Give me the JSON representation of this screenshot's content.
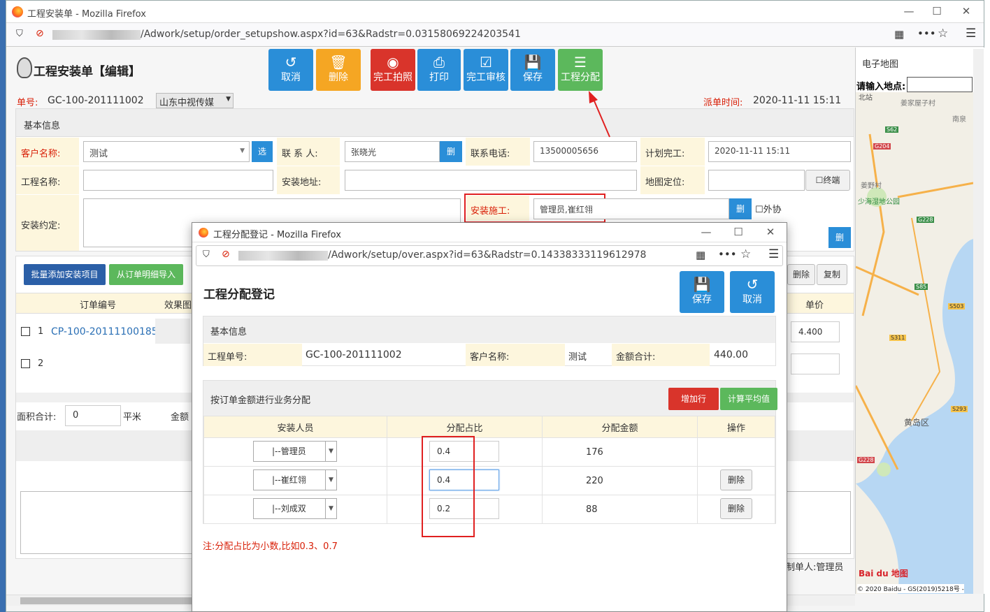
{
  "main_window": {
    "title": "工程安装单 - Mozilla Firefox",
    "url": "/Adwork/setup/order_setupshow.aspx?id=63&Radstr=0.03158069224203541"
  },
  "header": {
    "title": "工程安装单【编辑】",
    "order_no_label": "单号:",
    "order_no": "GC-100-201111002",
    "company": "山东中视传媒",
    "dispatch_label": "派单时间:",
    "dispatch_time": "2020-11-11 15:11"
  },
  "toolbar": {
    "cancel": "取消",
    "delete": "删除",
    "photo": "完工拍照",
    "print": "打印",
    "review": "完工审核",
    "save": "保存",
    "assign": "工程分配"
  },
  "basic_info": {
    "section": "基本信息",
    "customer_label": "客户名称:",
    "customer": "测试",
    "select_btn": "选",
    "contact_label": "联 系 人:",
    "contact": "张晓光",
    "del_btn": "删",
    "phone_label": "联系电话:",
    "phone": "13500005656",
    "plan_label": "计划完工:",
    "plan": "2020-11-11 15:11",
    "project_label": "工程名称:",
    "address_label": "安装地址:",
    "mapcoord_label": "地图定位:",
    "terminal": "终端",
    "agreement_label": "安装约定:",
    "installer_label": "安装施工:",
    "installer": "管理员,崔红翎",
    "outsource": "外协"
  },
  "items": {
    "add_batch": "批量添加安装项目",
    "import": "从订单明细导入",
    "delete": "删除",
    "copy": "复制",
    "col_order": "订单编号",
    "col_effect": "效果图",
    "col_price": "单价",
    "row1_no": "1",
    "row1_order": "CP-100-20111100185",
    "row1_price": "4.400",
    "row2_no": "2",
    "area_label": "面积合计:",
    "area": "0",
    "area_unit": "平米",
    "amount_label": "金额"
  },
  "footer": {
    "maker_label": "制单人:",
    "maker": "管理员"
  },
  "map": {
    "title": "电子地图",
    "search_label": "请输入地点:",
    "labels": [
      "北站",
      "姜家屋子村",
      "南泉",
      "G204",
      "S62",
      "姜野村",
      "少海湿地公园",
      "G228",
      "S85",
      "S503",
      "S311",
      "黄岛区",
      "S293",
      "G228"
    ],
    "logo": "Bai du 地图",
    "copyright": "© 2020 Baidu - GS(2019)5218号 -"
  },
  "popup": {
    "title": "工程分配登记 - Mozilla Firefox",
    "url": "/Adwork/setup/over.aspx?id=63&Radstr=0.14338333119612978",
    "heading": "工程分配登记",
    "save": "保存",
    "cancel": "取消",
    "basic_section": "基本信息",
    "project_no_label": "工程单号:",
    "project_no": "GC-100-201111002",
    "customer_label": "客户名称:",
    "customer": "测试",
    "total_label": "金额合计:",
    "total": "440.00",
    "alloc_section": "按订单金额进行业务分配",
    "add_row": "增加行",
    "avg": "计算平均值",
    "col_person": "安装人员",
    "col_ratio": "分配占比",
    "col_amount": "分配金额",
    "col_op": "操作",
    "rows": [
      {
        "person": "|--管理员",
        "ratio": "0.4",
        "amount": "176",
        "op": ""
      },
      {
        "person": "|--崔红翎",
        "ratio": "0.4",
        "amount": "220",
        "op": "删除"
      },
      {
        "person": "|--刘成双",
        "ratio": "0.2",
        "amount": "88",
        "op": "删除"
      }
    ],
    "note": "注:分配占比为小数,比如0.3、0.7"
  },
  "colors": {
    "blue": "#2a8ed8",
    "orange": "#f5a623",
    "red": "#d9342b",
    "green": "#5cb85c",
    "highlight": "#e02020"
  }
}
